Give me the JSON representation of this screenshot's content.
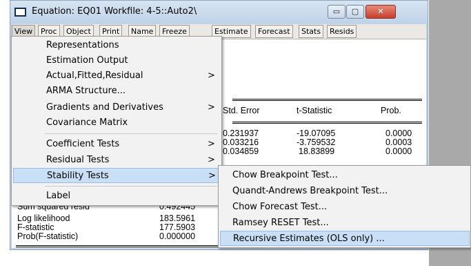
{
  "window": {
    "title": "Equation: EQ01   Workfile: 4-5::Auto2\\",
    "controls": {
      "minimize": "▭",
      "maximize": "▢",
      "close": "✕"
    }
  },
  "toolbar": [
    "View",
    "Proc",
    "Object",
    "Print",
    "Name",
    "Freeze",
    "Estimate",
    "Forecast",
    "Stats",
    "Resids"
  ],
  "table": {
    "headers": [
      "Std. Error",
      "t-Statistic",
      "Prob."
    ],
    "rows": [
      [
        "0.231937",
        "-19.07095",
        "0.0000"
      ],
      [
        "0.033216",
        "-3.759532",
        "0.0003"
      ],
      [
        "0.034859",
        "18.83899",
        "0.0000"
      ]
    ]
  },
  "stats": [
    {
      "label": "Sum squared resid",
      "value": "0.492445"
    },
    {
      "label": "Log likelihood",
      "value": "183.5961"
    },
    {
      "label": "F-statistic",
      "value": "177.5903"
    },
    {
      "label": "Prob(F-statistic)",
      "value": "0.000000"
    }
  ],
  "view_menu": {
    "items": [
      {
        "label": "Representations",
        "submenu": false
      },
      {
        "label": "Estimation Output",
        "submenu": false
      },
      {
        "label": "Actual,Fitted,Residual",
        "submenu": true
      },
      {
        "label": "ARMA Structure...",
        "submenu": false
      },
      {
        "label": "Gradients and Derivatives",
        "submenu": true
      },
      {
        "label": "Covariance Matrix",
        "submenu": false
      },
      {
        "label": "Coefficient Tests",
        "submenu": true
      },
      {
        "label": "Residual Tests",
        "submenu": true
      },
      {
        "label": "Stability Tests",
        "submenu": true,
        "highlighted": true
      },
      {
        "label": "Label",
        "submenu": false
      }
    ],
    "arrow_glyph": ">"
  },
  "stability_submenu": {
    "items": [
      {
        "label": "Chow Breakpoint Test..."
      },
      {
        "label": "Quandt-Andrews Breakpoint Test..."
      },
      {
        "label": "Chow Forecast Test..."
      },
      {
        "label": "Ramsey RESET Test..."
      },
      {
        "label": "Recursive Estimates (OLS only) ...",
        "highlighted": true
      }
    ]
  },
  "colors": {
    "titlebar": "#bed3e8",
    "highlight": "#c8dff6",
    "close_button": "#c6402d"
  }
}
